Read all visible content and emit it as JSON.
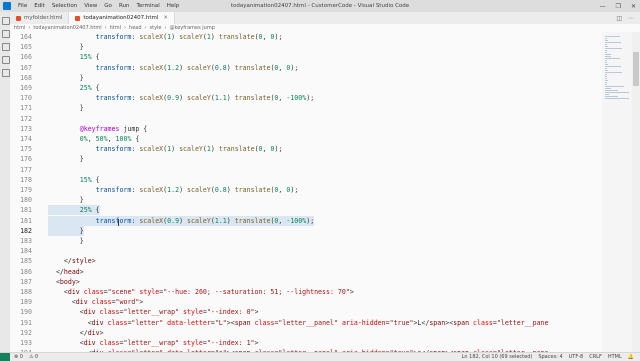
{
  "window": {
    "title": "todayanimation02407.html - CustomerCode - Visual Studio Code",
    "menu": [
      "File",
      "Edit",
      "Selection",
      "View",
      "Go",
      "Run",
      "Terminal",
      "Help"
    ],
    "controls": [
      "—",
      "❐",
      "✕"
    ]
  },
  "tabs": [
    {
      "label": "myfolder.html",
      "active": false
    },
    {
      "label": "todayanimation02407.html",
      "active": true
    }
  ],
  "breadcrumb": [
    "html",
    "todayanimation02407.html",
    "html",
    "head",
    "style",
    "@keyframes jump"
  ],
  "editor": {
    "lines": [
      {
        "n": "164",
        "code": [
          {
            "t": "            "
          },
          {
            "t": "transform",
            "c": "prop"
          },
          {
            "t": ": "
          },
          {
            "t": "scaleX",
            "c": "fn"
          },
          {
            "t": "("
          },
          {
            "t": "1",
            "c": "num"
          },
          {
            "t": ") "
          },
          {
            "t": "scaleY",
            "c": "fn"
          },
          {
            "t": "("
          },
          {
            "t": "1",
            "c": "num"
          },
          {
            "t": ") "
          },
          {
            "t": "translate",
            "c": "fn"
          },
          {
            "t": "("
          },
          {
            "t": "0",
            "c": "num"
          },
          {
            "t": ", "
          },
          {
            "t": "0",
            "c": "num"
          },
          {
            "t": ");"
          }
        ]
      },
      {
        "n": "165",
        "code": [
          {
            "t": "        }"
          }
        ]
      },
      {
        "n": "166",
        "code": [
          {
            "t": "        "
          },
          {
            "t": "15%",
            "c": "pct"
          },
          {
            "t": " {"
          }
        ]
      },
      {
        "n": "167",
        "code": [
          {
            "t": "            "
          },
          {
            "t": "transform",
            "c": "prop"
          },
          {
            "t": ": "
          },
          {
            "t": "scaleX",
            "c": "fn"
          },
          {
            "t": "("
          },
          {
            "t": "1.2",
            "c": "num"
          },
          {
            "t": ") "
          },
          {
            "t": "scaleY",
            "c": "fn"
          },
          {
            "t": "("
          },
          {
            "t": "0.8",
            "c": "num"
          },
          {
            "t": ") "
          },
          {
            "t": "translate",
            "c": "fn"
          },
          {
            "t": "("
          },
          {
            "t": "0",
            "c": "num"
          },
          {
            "t": ", "
          },
          {
            "t": "0",
            "c": "num"
          },
          {
            "t": ");"
          }
        ]
      },
      {
        "n": "168",
        "code": [
          {
            "t": "        }"
          }
        ]
      },
      {
        "n": "169",
        "code": [
          {
            "t": "        "
          },
          {
            "t": "25%",
            "c": "pct"
          },
          {
            "t": " {"
          }
        ]
      },
      {
        "n": "170",
        "code": [
          {
            "t": "            "
          },
          {
            "t": "transform",
            "c": "prop"
          },
          {
            "t": ": "
          },
          {
            "t": "scaleX",
            "c": "fn"
          },
          {
            "t": "("
          },
          {
            "t": "0.9",
            "c": "num"
          },
          {
            "t": ") "
          },
          {
            "t": "scaleY",
            "c": "fn"
          },
          {
            "t": "("
          },
          {
            "t": "1.1",
            "c": "num"
          },
          {
            "t": ") "
          },
          {
            "t": "translate",
            "c": "fn"
          },
          {
            "t": "("
          },
          {
            "t": "0",
            "c": "num"
          },
          {
            "t": ", "
          },
          {
            "t": "-100%",
            "c": "num"
          },
          {
            "t": ");"
          }
        ]
      },
      {
        "n": "171",
        "code": [
          {
            "t": "        }"
          }
        ]
      },
      {
        "n": "172",
        "code": [
          {
            "t": ""
          }
        ]
      },
      {
        "n": "173",
        "code": [
          {
            "t": "        "
          },
          {
            "t": "@keyframes",
            "c": "kw"
          },
          {
            "t": " jump {"
          }
        ]
      },
      {
        "n": "174",
        "code": [
          {
            "t": "        "
          },
          {
            "t": "0%",
            "c": "pct"
          },
          {
            "t": ", "
          },
          {
            "t": "50%",
            "c": "pct"
          },
          {
            "t": ", "
          },
          {
            "t": "100%",
            "c": "pct"
          },
          {
            "t": " {"
          }
        ]
      },
      {
        "n": "175",
        "code": [
          {
            "t": "            "
          },
          {
            "t": "transform",
            "c": "prop"
          },
          {
            "t": ": "
          },
          {
            "t": "scaleX",
            "c": "fn"
          },
          {
            "t": "("
          },
          {
            "t": "1",
            "c": "num"
          },
          {
            "t": ") "
          },
          {
            "t": "scaleY",
            "c": "fn"
          },
          {
            "t": "("
          },
          {
            "t": "1",
            "c": "num"
          },
          {
            "t": ") "
          },
          {
            "t": "translate",
            "c": "fn"
          },
          {
            "t": "("
          },
          {
            "t": "0",
            "c": "num"
          },
          {
            "t": ", "
          },
          {
            "t": "0",
            "c": "num"
          },
          {
            "t": ");"
          }
        ]
      },
      {
        "n": "176",
        "code": [
          {
            "t": "        }"
          }
        ]
      },
      {
        "n": "177",
        "code": [
          {
            "t": ""
          }
        ]
      },
      {
        "n": "178",
        "code": [
          {
            "t": "        "
          },
          {
            "t": "15%",
            "c": "pct"
          },
          {
            "t": " {"
          }
        ]
      },
      {
        "n": "179",
        "code": [
          {
            "t": "            "
          },
          {
            "t": "transform",
            "c": "prop"
          },
          {
            "t": ": "
          },
          {
            "t": "scaleX",
            "c": "fn"
          },
          {
            "t": "("
          },
          {
            "t": "1.2",
            "c": "num"
          },
          {
            "t": ") "
          },
          {
            "t": "scaleY",
            "c": "fn"
          },
          {
            "t": "("
          },
          {
            "t": "0.8",
            "c": "num"
          },
          {
            "t": ") "
          },
          {
            "t": "translate",
            "c": "fn"
          },
          {
            "t": "("
          },
          {
            "t": "0",
            "c": "num"
          },
          {
            "t": ", "
          },
          {
            "t": "0",
            "c": "num"
          },
          {
            "t": ");"
          }
        ]
      },
      {
        "n": "180",
        "code": [
          {
            "t": "        }"
          }
        ]
      },
      {
        "n": "181",
        "code": [
          {
            "t": "        "
          },
          {
            "t": "25%",
            "c": "pct"
          },
          {
            "t": " {"
          }
        ],
        "sel": true
      },
      {
        "n": "181",
        "code": [
          {
            "t": "            "
          },
          {
            "t": "transform",
            "c": "prop"
          },
          {
            "t": ": "
          },
          {
            "t": "scaleX",
            "c": "fn"
          },
          {
            "t": "("
          },
          {
            "t": "0.9",
            "c": "num"
          },
          {
            "t": ") "
          },
          {
            "t": "scaleY",
            "c": "fn"
          },
          {
            "t": "("
          },
          {
            "t": "1.1",
            "c": "num"
          },
          {
            "t": ") "
          },
          {
            "t": "translate",
            "c": "fn"
          },
          {
            "t": "("
          },
          {
            "t": "0",
            "c": "num"
          },
          {
            "t": ", "
          },
          {
            "t": "-100%",
            "c": "num"
          },
          {
            "t": ");"
          }
        ],
        "sel": true
      },
      {
        "n": "182",
        "code": [
          {
            "t": "        }"
          }
        ],
        "sel": true,
        "cur": true
      },
      {
        "n": "183",
        "code": [
          {
            "t": "        }"
          }
        ]
      },
      {
        "n": "184",
        "code": [
          {
            "t": ""
          }
        ]
      },
      {
        "n": "185",
        "code": [
          {
            "t": "    </"
          },
          {
            "t": "style",
            "c": "tag"
          },
          {
            "t": ">"
          }
        ]
      },
      {
        "n": "186",
        "code": [
          {
            "t": "  </"
          },
          {
            "t": "head",
            "c": "tag"
          },
          {
            "t": ">"
          }
        ]
      },
      {
        "n": "187",
        "code": [
          {
            "t": "  <"
          },
          {
            "t": "body",
            "c": "tag"
          },
          {
            "t": ">"
          }
        ]
      },
      {
        "n": "188",
        "code": [
          {
            "t": "    <"
          },
          {
            "t": "div",
            "c": "tag"
          },
          {
            "t": " "
          },
          {
            "t": "class",
            "c": "attr"
          },
          {
            "t": "="
          },
          {
            "t": "\"scene\"",
            "c": "str"
          },
          {
            "t": " "
          },
          {
            "t": "style",
            "c": "attr"
          },
          {
            "t": "="
          },
          {
            "t": "\"--hue: 260; --saturation: 51; --lightness: 70\"",
            "c": "str"
          },
          {
            "t": ">"
          }
        ]
      },
      {
        "n": "189",
        "code": [
          {
            "t": "      <"
          },
          {
            "t": "div",
            "c": "tag"
          },
          {
            "t": " "
          },
          {
            "t": "class",
            "c": "attr"
          },
          {
            "t": "="
          },
          {
            "t": "\"word\"",
            "c": "str"
          },
          {
            "t": ">"
          }
        ]
      },
      {
        "n": "190",
        "code": [
          {
            "t": "        <"
          },
          {
            "t": "div",
            "c": "tag"
          },
          {
            "t": " "
          },
          {
            "t": "class",
            "c": "attr"
          },
          {
            "t": "="
          },
          {
            "t": "\"letter__wrap\"",
            "c": "str"
          },
          {
            "t": " "
          },
          {
            "t": "style",
            "c": "attr"
          },
          {
            "t": "="
          },
          {
            "t": "\"--index: 0\"",
            "c": "str"
          },
          {
            "t": ">"
          }
        ]
      },
      {
        "n": "191",
        "code": [
          {
            "t": "          <"
          },
          {
            "t": "div",
            "c": "tag"
          },
          {
            "t": " "
          },
          {
            "t": "class",
            "c": "attr"
          },
          {
            "t": "="
          },
          {
            "t": "\"letter\"",
            "c": "str"
          },
          {
            "t": " "
          },
          {
            "t": "data-letter",
            "c": "attr"
          },
          {
            "t": "="
          },
          {
            "t": "\"L\"",
            "c": "str"
          },
          {
            "t": "><"
          },
          {
            "t": "span",
            "c": "tag"
          },
          {
            "t": " "
          },
          {
            "t": "class",
            "c": "attr"
          },
          {
            "t": "="
          },
          {
            "t": "\"letter__panel\"",
            "c": "str"
          },
          {
            "t": " "
          },
          {
            "t": "aria-hidden",
            "c": "attr"
          },
          {
            "t": "="
          },
          {
            "t": "\"true\"",
            "c": "str"
          },
          {
            "t": ">L</"
          },
          {
            "t": "span",
            "c": "tag"
          },
          {
            "t": "><"
          },
          {
            "t": "span",
            "c": "tag"
          },
          {
            "t": " "
          },
          {
            "t": "class",
            "c": "attr"
          },
          {
            "t": "="
          },
          {
            "t": "\"letter__pane",
            "c": "str"
          }
        ]
      },
      {
        "n": "192",
        "code": [
          {
            "t": "        </"
          },
          {
            "t": "div",
            "c": "tag"
          },
          {
            "t": ">"
          }
        ]
      },
      {
        "n": "193",
        "code": [
          {
            "t": "        <"
          },
          {
            "t": "div",
            "c": "tag"
          },
          {
            "t": " "
          },
          {
            "t": "class",
            "c": "attr"
          },
          {
            "t": "="
          },
          {
            "t": "\"letter__wrap\"",
            "c": "str"
          },
          {
            "t": " "
          },
          {
            "t": "style",
            "c": "attr"
          },
          {
            "t": "="
          },
          {
            "t": "\"--index: 1\"",
            "c": "str"
          },
          {
            "t": ">"
          }
        ]
      },
      {
        "n": "194",
        "code": [
          {
            "t": "          <"
          },
          {
            "t": "div",
            "c": "tag"
          },
          {
            "t": " "
          },
          {
            "t": "class",
            "c": "attr"
          },
          {
            "t": "="
          },
          {
            "t": "\"letter\"",
            "c": "str"
          },
          {
            "t": " "
          },
          {
            "t": "data-letter",
            "c": "attr"
          },
          {
            "t": "="
          },
          {
            "t": "\"o\"",
            "c": "str"
          },
          {
            "t": "><"
          },
          {
            "t": "span",
            "c": "tag"
          },
          {
            "t": " "
          },
          {
            "t": "class",
            "c": "attr"
          },
          {
            "t": "="
          },
          {
            "t": "\"letter__panel\"",
            "c": "str"
          },
          {
            "t": " "
          },
          {
            "t": "aria-hidden",
            "c": "attr"
          },
          {
            "t": "="
          },
          {
            "t": "\"true\"",
            "c": "str"
          },
          {
            "t": ">o</"
          },
          {
            "t": "span",
            "c": "tag"
          },
          {
            "t": "><"
          },
          {
            "t": "span",
            "c": "tag"
          },
          {
            "t": " "
          },
          {
            "t": "class",
            "c": "attr"
          },
          {
            "t": "="
          },
          {
            "t": "\"letter__pane",
            "c": "str"
          }
        ]
      }
    ]
  },
  "statusbar": {
    "left": [
      "⊗ 0",
      "⚠ 0"
    ],
    "right": [
      "Ln 182, Col 10 (69 selected)",
      "Spaces: 4",
      "UTF-8",
      "CRLF",
      "HTML",
      "🔔"
    ]
  }
}
